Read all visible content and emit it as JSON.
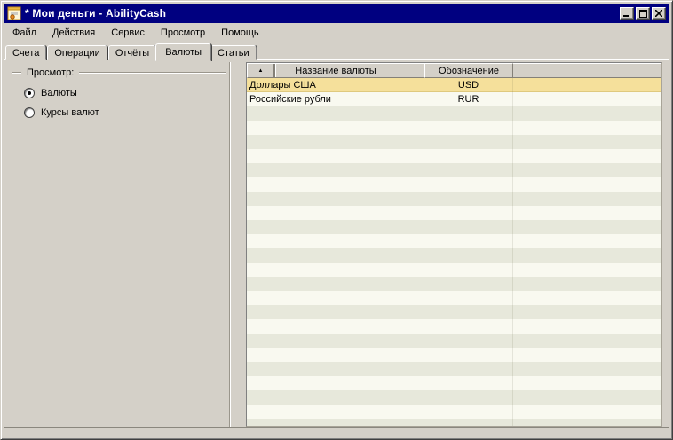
{
  "window": {
    "title": "* Мои деньги - AbilityCash"
  },
  "icons": {
    "app_icon": "ledger-with-coin",
    "minimize": "_",
    "maximize": "□",
    "close": "✕",
    "sort_asc": "▲"
  },
  "colors": {
    "titlebar": "#000080",
    "chrome": "#D4D0C8",
    "row_selected": "#F5E09B",
    "row_stripe_light": "#F9F9F0",
    "row_stripe_dark": "#E7E8DB"
  },
  "menu": {
    "items": [
      "Файл",
      "Действия",
      "Сервис",
      "Просмотр",
      "Помощь"
    ]
  },
  "tabs": [
    {
      "label": "Счета",
      "active": false
    },
    {
      "label": "Операции",
      "active": false
    },
    {
      "label": "Отчёты",
      "active": false
    },
    {
      "label": "Валюты",
      "active": true
    },
    {
      "label": "Статьи",
      "active": false
    }
  ],
  "view_group": {
    "title": "Просмотр:",
    "options": [
      {
        "label": "Валюты",
        "selected": true
      },
      {
        "label": "Курсы валют",
        "selected": false
      }
    ]
  },
  "grid": {
    "columns": [
      {
        "label": "Название валюты",
        "sorted": "asc"
      },
      {
        "label": "Обозначение",
        "sorted": null
      },
      {
        "label": "",
        "sorted": null
      }
    ],
    "rows": [
      {
        "name": "Доллары США",
        "code": "USD",
        "selected": true
      },
      {
        "name": "Российские рубли",
        "code": "RUR",
        "selected": false
      }
    ],
    "empty_row_count": 23
  }
}
